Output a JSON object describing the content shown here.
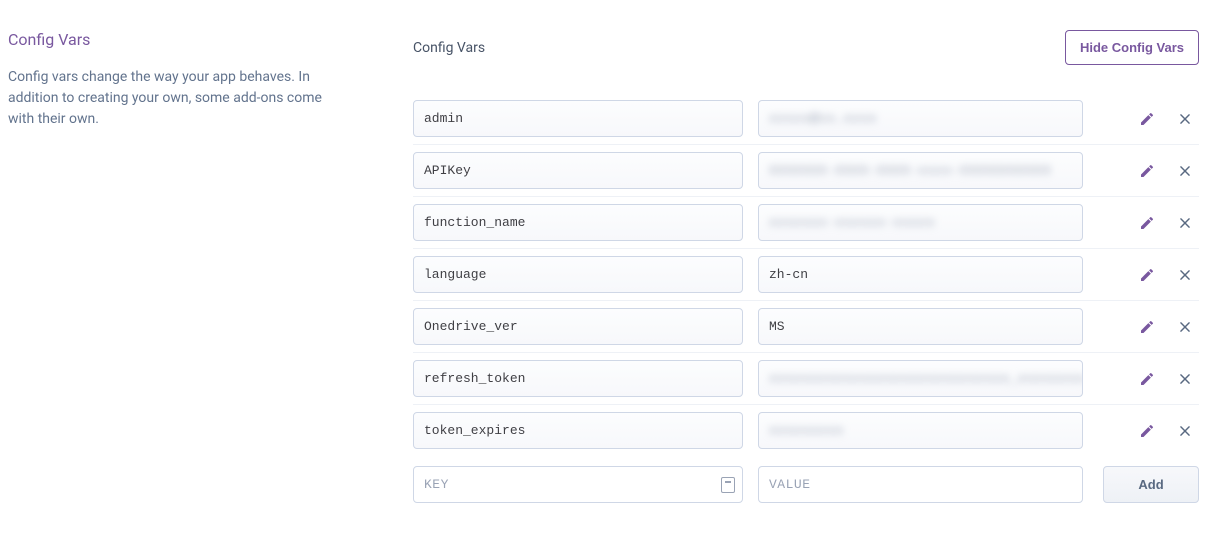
{
  "sidebar": {
    "title": "Config Vars",
    "description": "Config vars change the way your app behaves. In addition to creating your own, some add-ons come with their own."
  },
  "header": {
    "label": "Config Vars",
    "hide_button": "Hide Config Vars"
  },
  "vars": [
    {
      "key": "admin",
      "value": "xxxxx@xx.xxxx",
      "blurred": true
    },
    {
      "key": "APIKey",
      "value": "XXXXXXX-XXXX-XXXX-xxxx-XXXXXXXXXXX",
      "blurred": true
    },
    {
      "key": "function_name",
      "value": "xxxxxxx-xxxxxx-xxxxx",
      "blurred": true
    },
    {
      "key": "language",
      "value": "zh-cn",
      "blurred": false
    },
    {
      "key": "Onedrive_ver",
      "value": "MS",
      "blurred": false
    },
    {
      "key": "refresh_token",
      "value": "xxxxxxxxxxxxxxxxxxxxxxxxxxxxx_xxxxxxxx_xxx",
      "blurred": true
    },
    {
      "key": "token_expires",
      "value": "xxxxxxxxx",
      "blurred": true
    }
  ],
  "new_row": {
    "key_placeholder": "KEY",
    "value_placeholder": "VALUE",
    "add_button": "Add"
  }
}
